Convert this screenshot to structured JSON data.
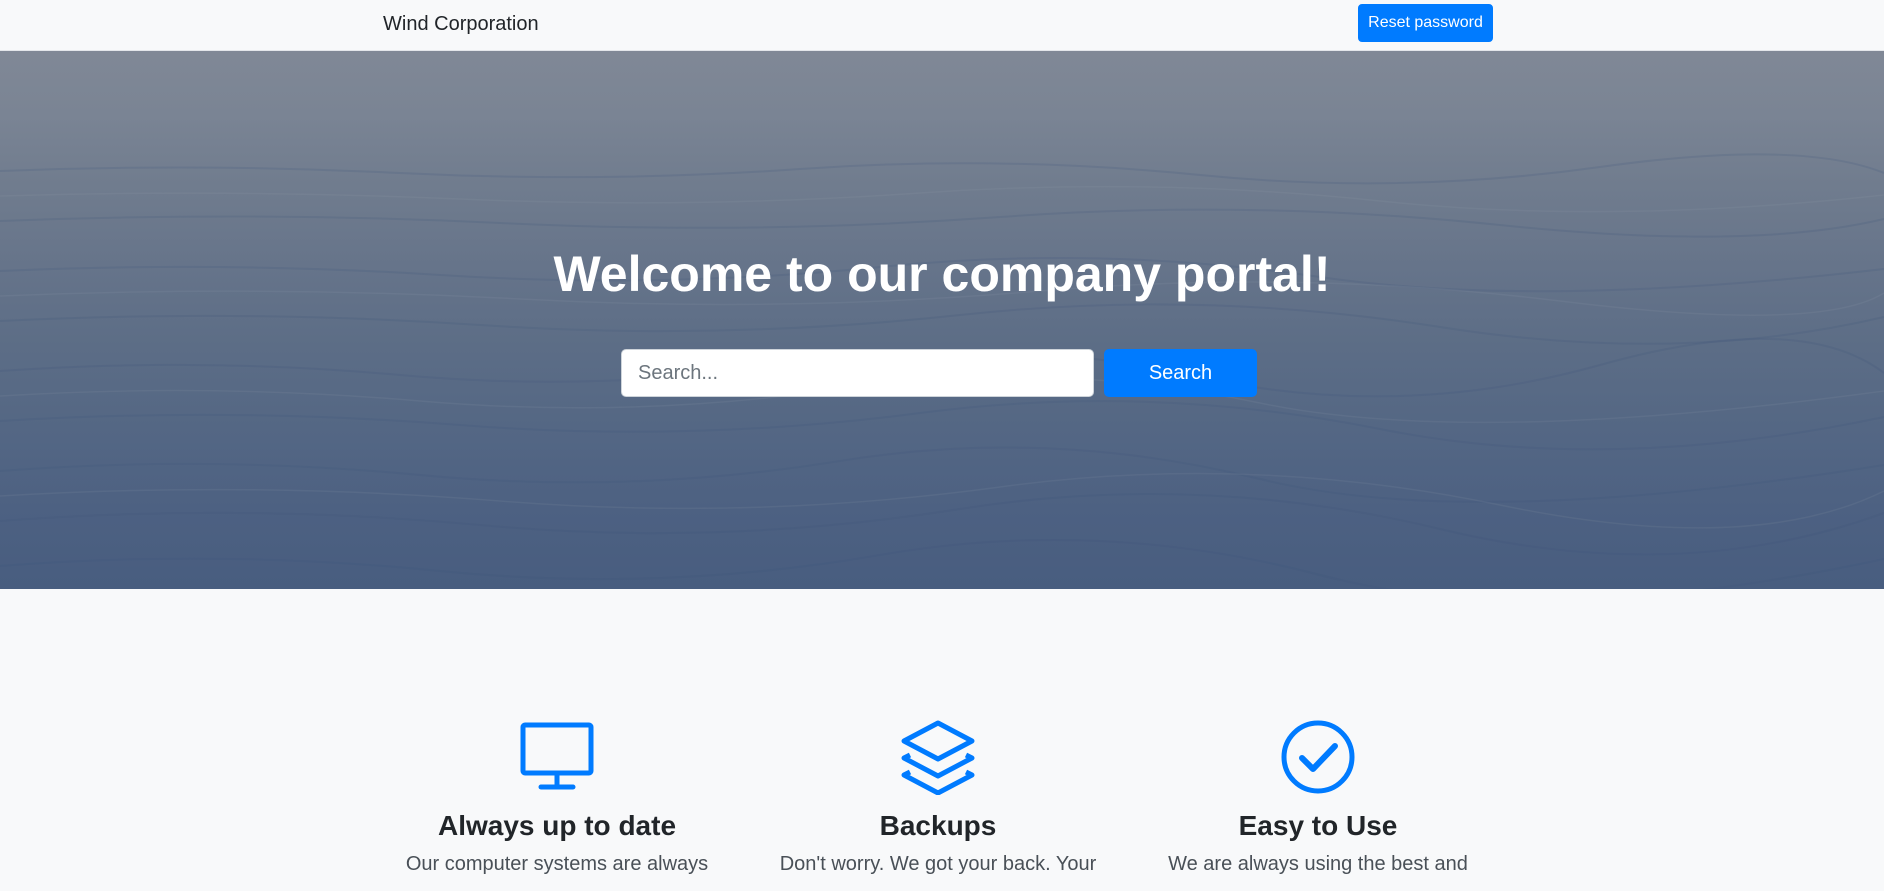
{
  "navbar": {
    "brand": "Wind Corporation",
    "reset_label": "Reset password"
  },
  "hero": {
    "title": "Welcome to our company portal!",
    "search_placeholder": "Search...",
    "search_value": "",
    "search_button": "Search"
  },
  "features": [
    {
      "icon": "monitor-icon",
      "title": "Always up to date",
      "text": "Our computer systems are always"
    },
    {
      "icon": "layers-icon",
      "title": "Backups",
      "text": "Don't worry. We got your back. Your"
    },
    {
      "icon": "check-circle-icon",
      "title": "Easy to Use",
      "text": "We are always using the best and"
    }
  ],
  "colors": {
    "accent": "#007bff",
    "page_background": "#f8f9fa",
    "text": "#212529"
  }
}
